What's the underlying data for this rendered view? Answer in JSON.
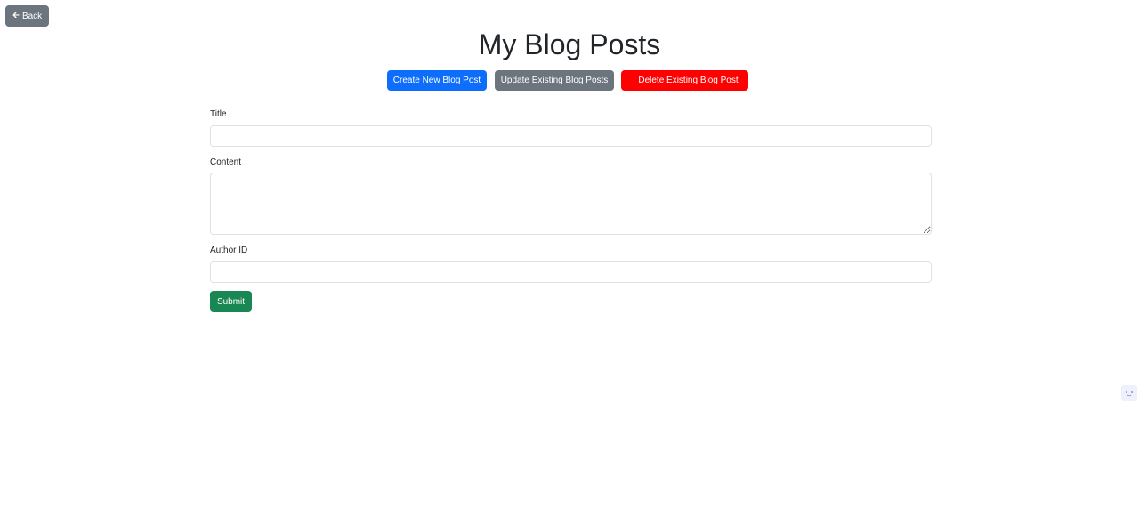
{
  "nav": {
    "back_label": "Back",
    "back_icon": "arrow-left-icon"
  },
  "page_title": "My Blog Posts",
  "actions": {
    "create_label": "Create New Blog Post",
    "update_label": "Update Existing Blog Posts",
    "delete_label": "Delete Existing Blog Post"
  },
  "form": {
    "title_label": "Title",
    "title_value": "",
    "content_label": "Content",
    "content_value": "",
    "author_label": "Author ID",
    "author_value": "",
    "submit_label": "Submit"
  },
  "side_widget": {
    "icon": "extension-widget-icon"
  },
  "colors": {
    "primary": "#0d6efd",
    "secondary": "#6c757d",
    "danger": "#ff0000",
    "success": "#198754"
  }
}
